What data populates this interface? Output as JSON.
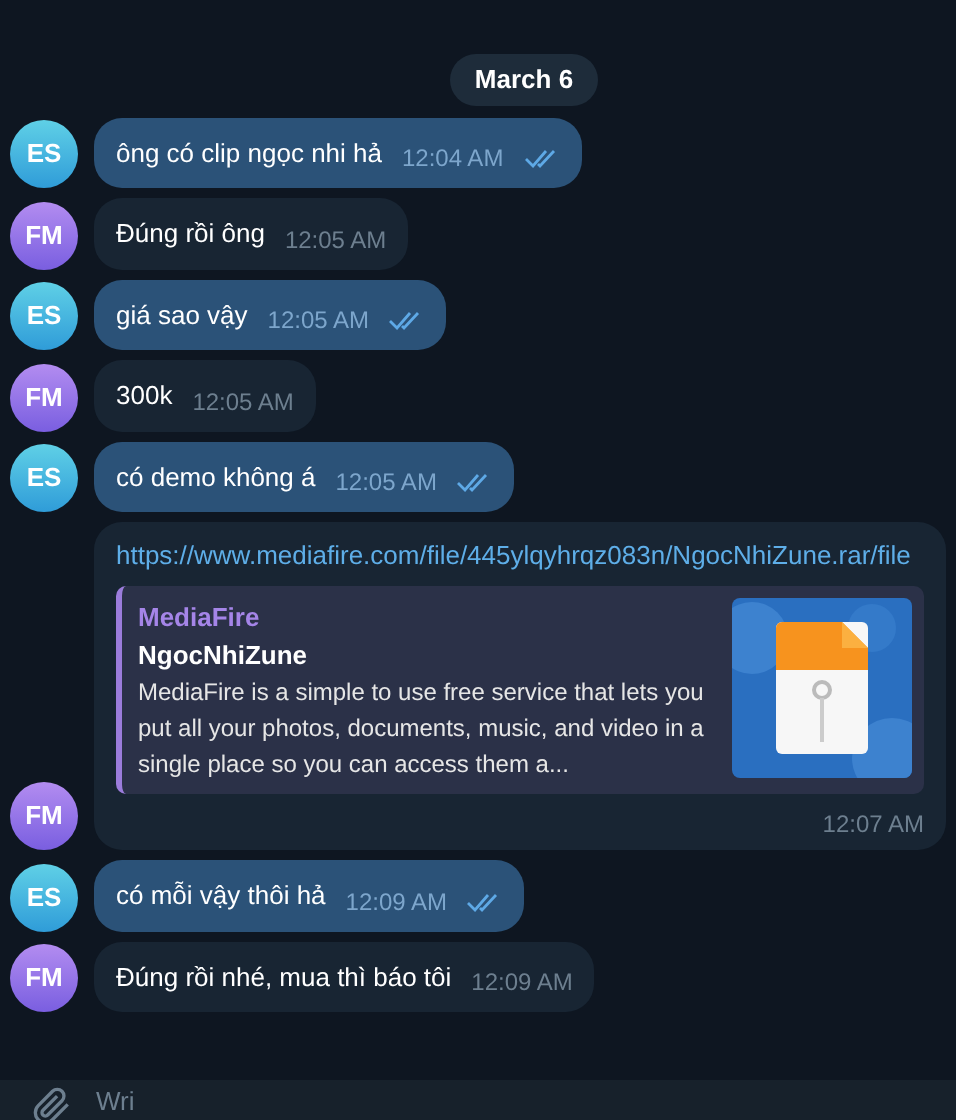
{
  "date_badge": "March 6",
  "messages": [
    {
      "kind": "sent",
      "avatar": "ES",
      "text": "ông có clip ngọc nhi hả",
      "time": "12:04 AM",
      "read": true
    },
    {
      "kind": "received",
      "avatar": "FM",
      "text": "Đúng rồi ông",
      "time": "12:05 AM"
    },
    {
      "kind": "sent",
      "avatar": "ES",
      "text": "giá sao vậy",
      "time": "12:05 AM",
      "read": true
    },
    {
      "kind": "received",
      "avatar": "FM",
      "text": "300k",
      "time": "12:05 AM"
    },
    {
      "kind": "sent",
      "avatar": "ES",
      "text": "có demo không á",
      "time": "12:05 AM",
      "read": true
    },
    {
      "kind": "link",
      "avatar": "FM",
      "url": "https://www.mediafire.com/file/445ylqyhrqz083n/NgocNhiZune.rar/file",
      "preview": {
        "site": "MediaFire",
        "title": "NgocNhiZune",
        "description": "MediaFire is a simple to use free service that lets you put all your photos, documents, music, and video in a single place so you can access them a..."
      },
      "time": "12:07 AM"
    },
    {
      "kind": "sent",
      "avatar": "ES",
      "text": "có mỗi vậy thôi hả",
      "time": "12:09 AM",
      "read": true
    },
    {
      "kind": "received",
      "avatar": "FM",
      "text": "Đúng rồi nhé, mua thì báo tôi",
      "time": "12:09 AM"
    }
  ],
  "composer": {
    "placeholder": "Wri"
  }
}
